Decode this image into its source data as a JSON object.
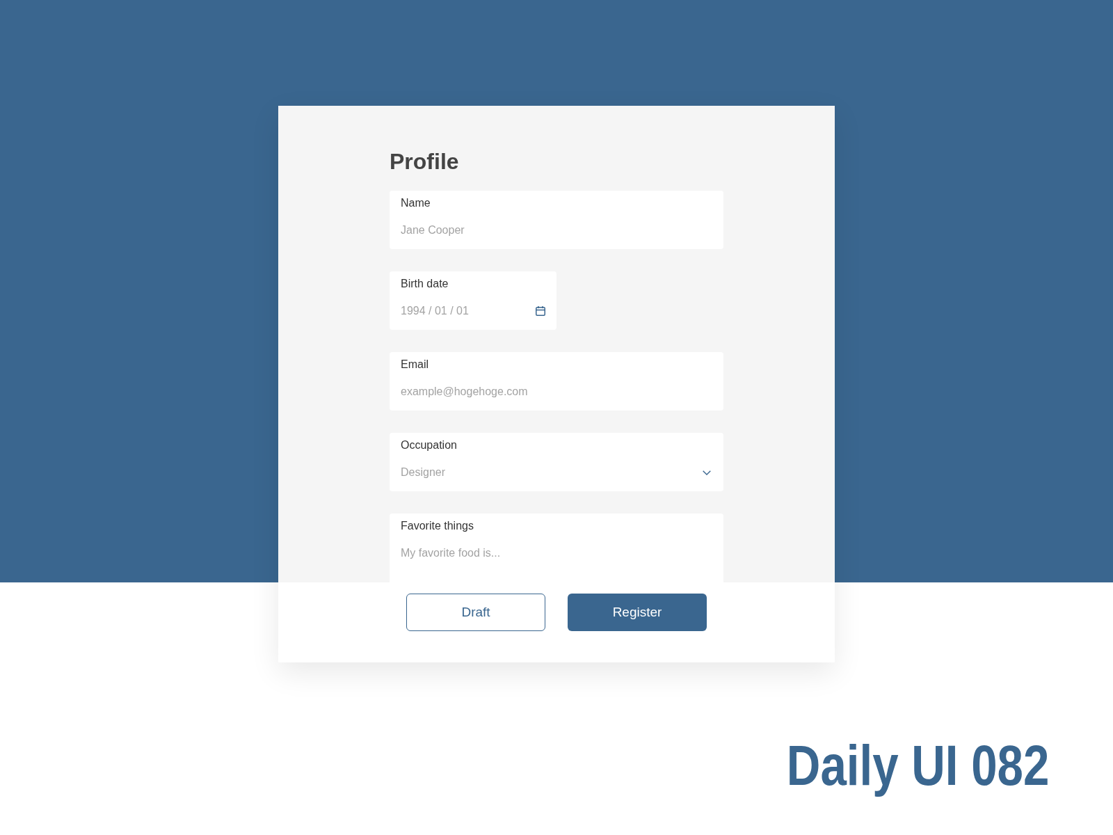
{
  "title": "Profile",
  "fields": [
    {
      "kind": "text",
      "label": "Name",
      "placeholder": "Jane Cooper"
    },
    {
      "kind": "date",
      "label": "Birth date",
      "placeholder": "1994 / 01 / 01"
    },
    {
      "kind": "text",
      "label": "Email",
      "placeholder": "example@hogehoge.com"
    },
    {
      "kind": "select",
      "label": "Occupation",
      "placeholder": "Designer"
    },
    {
      "kind": "textarea",
      "label": "Favorite things",
      "placeholder": "My favorite food is..."
    }
  ],
  "buttons": [
    {
      "kind": "secondary",
      "label": "Draft"
    },
    {
      "kind": "primary",
      "label": "Register"
    }
  ],
  "footer_title": "Daily UI 082"
}
